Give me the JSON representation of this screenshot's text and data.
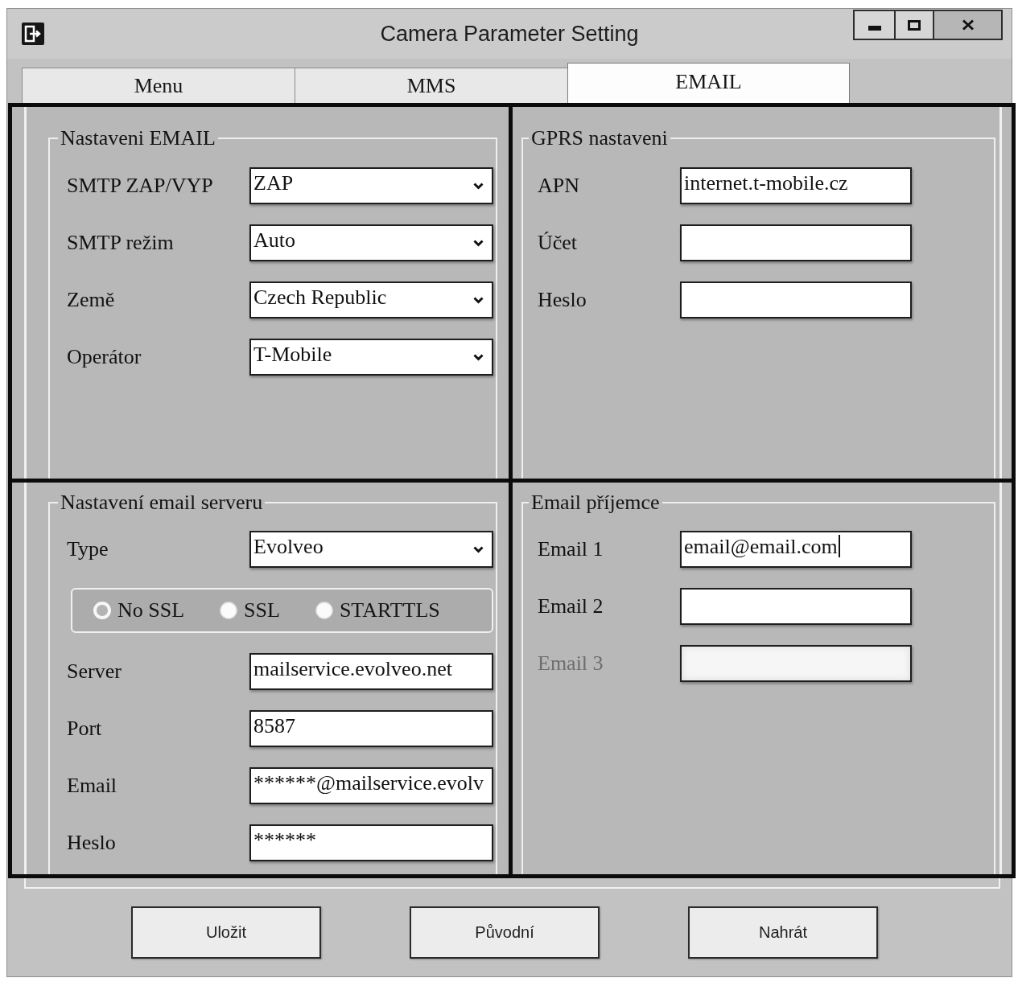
{
  "window": {
    "title": "Camera Parameter Setting"
  },
  "tabs": [
    {
      "label": "Menu",
      "selected": false
    },
    {
      "label": "MMS",
      "selected": false
    },
    {
      "label": "EMAIL",
      "selected": true
    }
  ],
  "email_settings": {
    "title": "Nastaveni EMAIL",
    "fields": [
      {
        "kind": "dropdown",
        "label": "SMTP ZAP/VYP",
        "value": "ZAP"
      },
      {
        "kind": "dropdown",
        "label": "SMTP režim",
        "value": "Auto"
      },
      {
        "kind": "dropdown",
        "label": "Země",
        "value": "Czech Republic"
      },
      {
        "kind": "dropdown",
        "label": "Operátor",
        "value": "T-Mobile"
      }
    ]
  },
  "gprs_settings": {
    "title": "GPRS nastaveni",
    "fields": [
      {
        "kind": "text",
        "label": "APN",
        "value": "internet.t-mobile.cz"
      },
      {
        "kind": "text",
        "label": "Účet"
      },
      {
        "kind": "text",
        "label": "Heslo"
      }
    ]
  },
  "email_server": {
    "title": "Nastavení email serveru",
    "fields": [
      {
        "kind": "dropdown",
        "label": "Type",
        "value": "Evolveo"
      },
      {
        "kind": "radio_group",
        "options": [
          {
            "label": "No SSL",
            "selected": true
          },
          {
            "label": "SSL",
            "selected": false
          },
          {
            "label": "STARTTLS",
            "selected": false
          }
        ]
      },
      {
        "kind": "text",
        "label": "Server",
        "value": "mailservice.evolveo.net"
      },
      {
        "kind": "text",
        "label": "Port",
        "value": "8587"
      },
      {
        "kind": "text",
        "label": "Email",
        "value": "******@mailservice.evolv"
      },
      {
        "kind": "text",
        "label": "Heslo",
        "value": "******"
      }
    ]
  },
  "email_recipients": {
    "title": "Email příjemce",
    "fields": [
      {
        "kind": "text",
        "label": "Email 1",
        "value": "email@email.com",
        "focused": true,
        "disabled": false
      },
      {
        "kind": "text",
        "label": "Email 2",
        "focused": false,
        "disabled": false
      },
      {
        "kind": "text",
        "label": "Email 3",
        "focused": false,
        "disabled": true
      }
    ]
  },
  "buttons": [
    "Uložit",
    "Původní",
    "Nahrát"
  ]
}
